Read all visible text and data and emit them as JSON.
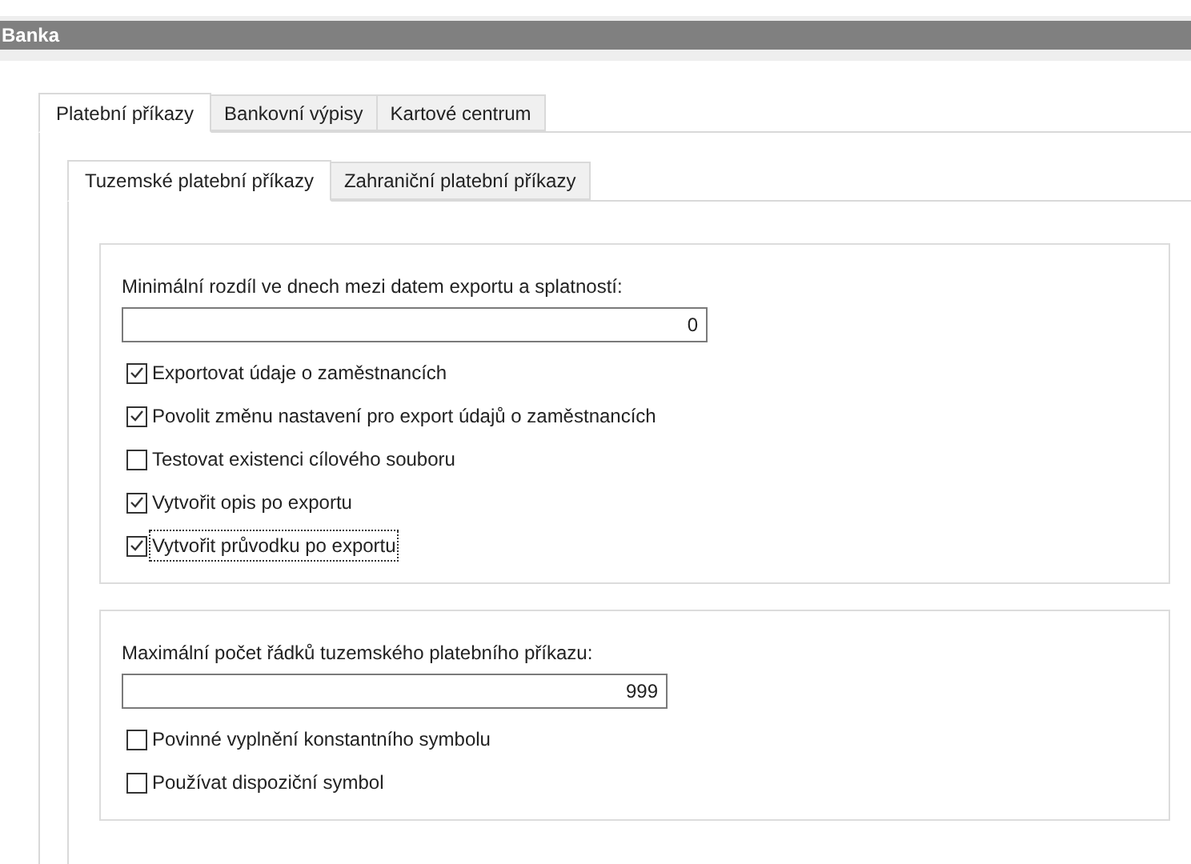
{
  "window": {
    "title": "Banka"
  },
  "tabs": [
    {
      "label": "Platební příkazy",
      "selected": true
    },
    {
      "label": "Bankovní výpisy",
      "selected": false
    },
    {
      "label": "Kartové centrum",
      "selected": false
    }
  ],
  "subtabs": [
    {
      "label": "Tuzemské platební příkazy",
      "selected": true
    },
    {
      "label": "Zahraniční platební příkazy",
      "selected": false
    }
  ],
  "groups": [
    {
      "field_label": "Minimální rozdíl ve dnech mezi datem exportu a splatností:",
      "value": "0",
      "options": [
        {
          "label": "Exportovat údaje o zaměstnancích",
          "checked": true,
          "focused": false
        },
        {
          "label": "Povolit změnu nastavení pro export údajů o zaměstnancích",
          "checked": true,
          "focused": false
        },
        {
          "label": "Testovat existenci cílového souboru",
          "checked": false,
          "focused": false
        },
        {
          "label": "Vytvořit opis po exportu",
          "checked": true,
          "focused": false
        },
        {
          "label": "Vytvořit průvodku po exportu",
          "checked": true,
          "focused": true
        }
      ]
    },
    {
      "field_label": "Maximální počet řádků tuzemského platebního příkazu:",
      "value": "999",
      "options": [
        {
          "label": "Povinné vyplnění konstantního symbolu",
          "checked": false,
          "focused": false
        },
        {
          "label": "Používat dispoziční symbol",
          "checked": false,
          "focused": false
        }
      ]
    }
  ]
}
